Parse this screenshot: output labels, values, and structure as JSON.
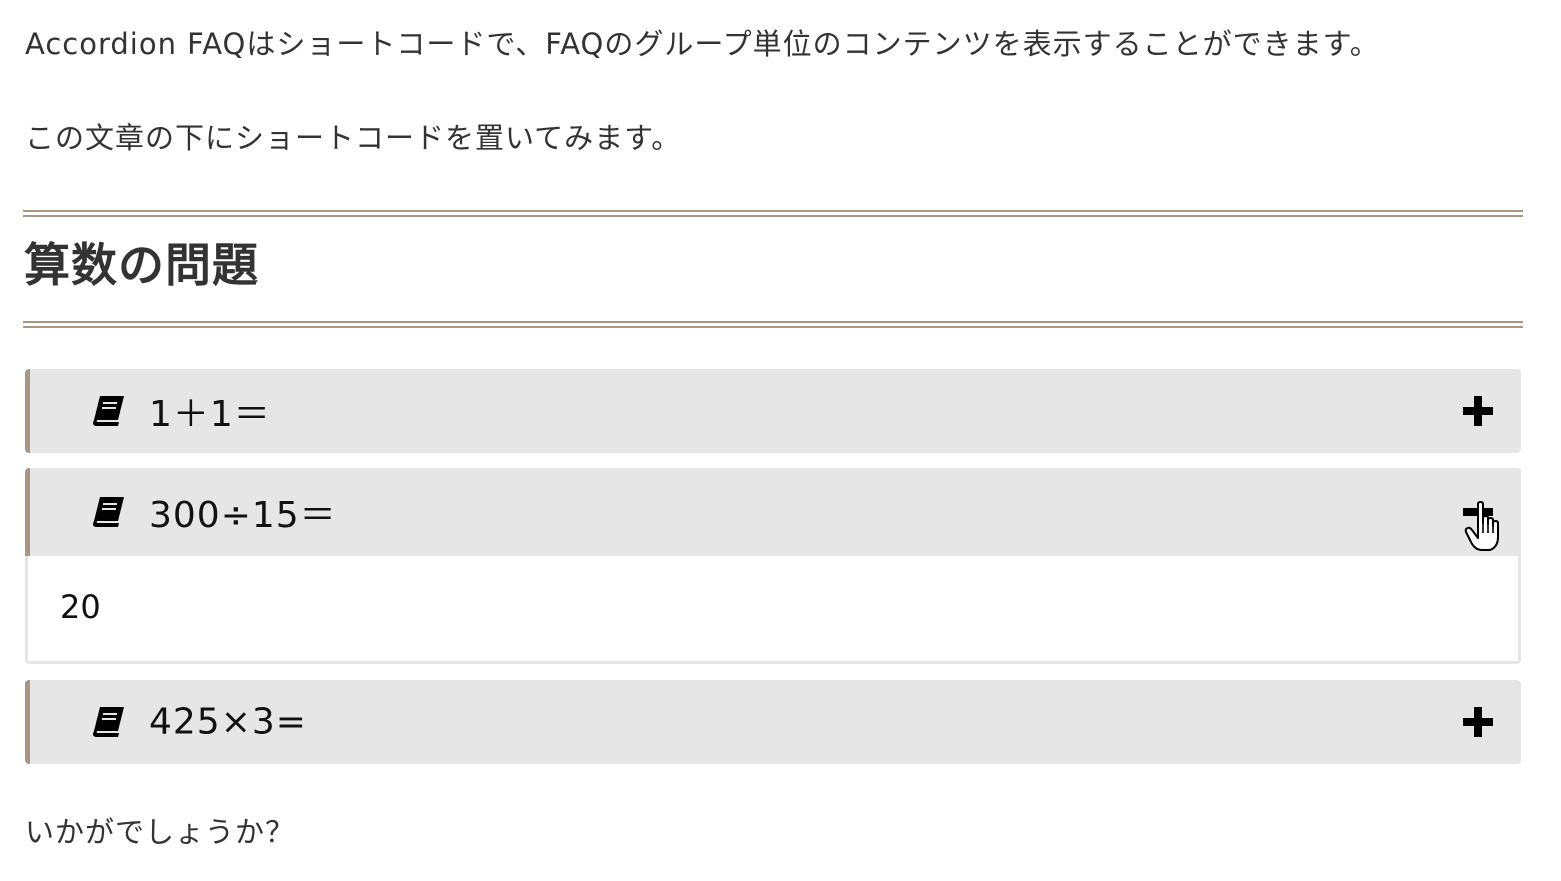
{
  "intro": {
    "line1": "Accordion FAQはショートコードで、FAQのグループ単位のコンテンツを表示することができます。",
    "line2": "この文章の下にショートコードを置いてみます。"
  },
  "group": {
    "title": "算数の問題"
  },
  "faq": [
    {
      "question": "1＋1＝",
      "expanded": false,
      "icon": "book-icon",
      "toggle_icon": "plus-icon"
    },
    {
      "question": "300÷15＝",
      "answer": "20",
      "expanded": true,
      "icon": "book-icon",
      "toggle_icon": "minus-icon"
    },
    {
      "question": "425×3=",
      "expanded": false,
      "icon": "book-icon",
      "toggle_icon": "plus-icon"
    }
  ],
  "outro": "いかがでしょうか？",
  "colors": {
    "accent": "#a99683",
    "question_bg": "#e6e6e6",
    "text": "#333333"
  }
}
